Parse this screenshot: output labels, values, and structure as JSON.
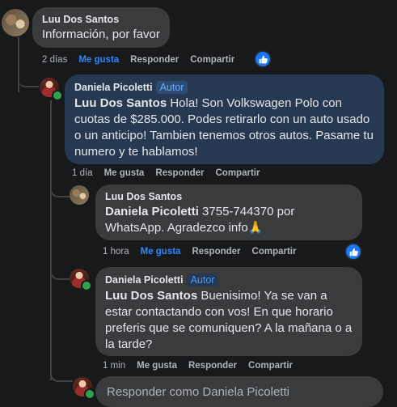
{
  "comments": [
    {
      "author": "Luu Dos Santos",
      "badge": "",
      "mention": "",
      "text": "Información, por favor",
      "time": "2 días",
      "like_label": "Me gusta",
      "reply_label": "Responder",
      "share_label": "Compartir",
      "liked": true,
      "has_reaction": true,
      "reaction_icon": "like-icon"
    },
    {
      "author": "Daniela Picoletti",
      "badge": "Autor",
      "mention": "Luu Dos Santos",
      "text": " Hola! Son Volkswagen Polo con cuotas de $285.000. Podes retirarlo con un auto usado o un anticipo! Tambien tenemos otros autos. Pasame tu numero y te hablamos!",
      "time": "1 día",
      "like_label": "Me gusta",
      "reply_label": "Responder",
      "share_label": "Compartir",
      "liked": false,
      "has_reaction": false
    },
    {
      "author": "Luu Dos Santos",
      "badge": "",
      "mention": "Daniela Picoletti",
      "text": " 3755-744370 por WhatsApp. Agradezco info🙏",
      "time": "1 hora",
      "like_label": "Me gusta",
      "reply_label": "Responder",
      "share_label": "Compartir",
      "liked": true,
      "has_reaction": true,
      "reaction_icon": "like-icon"
    },
    {
      "author": "Daniela Picoletti",
      "badge": "Autor",
      "mention": "Luu Dos Santos",
      "text": " Buenisimo! Ya se van a estar contactando con vos! En que horario preferis que se comuniquen? A la mañana o a la tarde?",
      "time": "1 min",
      "like_label": "Me gusta",
      "reply_label": "Responder",
      "share_label": "Compartir",
      "liked": false,
      "has_reaction": false
    }
  ],
  "reply_box": {
    "placeholder": "Responder como Daniela Picoletti"
  },
  "colors": {
    "background": "#18191a",
    "bubble": "#3a3b3c",
    "highlight_bubble": "#263951",
    "accent": "#2d88ff",
    "online": "#31a24c"
  }
}
